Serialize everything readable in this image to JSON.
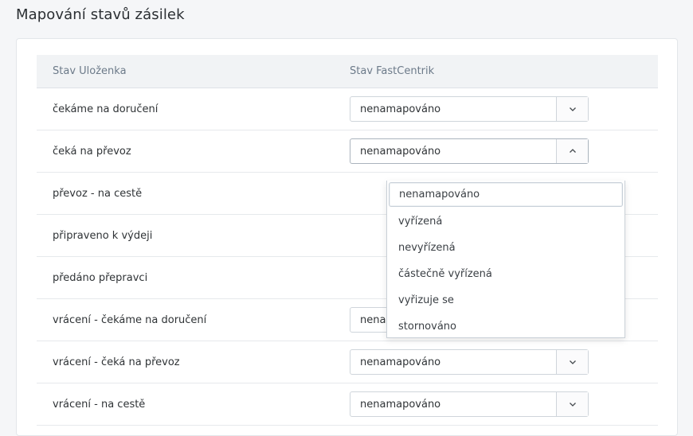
{
  "page": {
    "title": "Mapování stavů zásilek"
  },
  "table": {
    "headers": [
      "Stav Uloženka",
      "Stav FastCentrik"
    ],
    "rows": [
      {
        "label": "čekáme na doručení",
        "value": "nenamapováno"
      },
      {
        "label": "čeká na převoz",
        "value": "nenamapováno"
      },
      {
        "label": "převoz - na cestě",
        "value": ""
      },
      {
        "label": "připraveno k výdeji",
        "value": ""
      },
      {
        "label": "předáno přepravci",
        "value": ""
      },
      {
        "label": "vrácení - čekáme na doručení",
        "value": "nenamapováno"
      },
      {
        "label": "vrácení - čeká na převoz",
        "value": "nenamapováno"
      },
      {
        "label": "vrácení - na cestě",
        "value": "nenamapováno"
      }
    ]
  },
  "dropdown": {
    "selected": "nenamapováno",
    "options": [
      "nenamapováno",
      "vyřízená",
      "nevyřízená",
      "částečně vyřízená",
      "vyřizuje se",
      "stornováno"
    ]
  },
  "icons": {
    "closed": "chevron-down-icon",
    "open": "chevron-up-icon"
  }
}
